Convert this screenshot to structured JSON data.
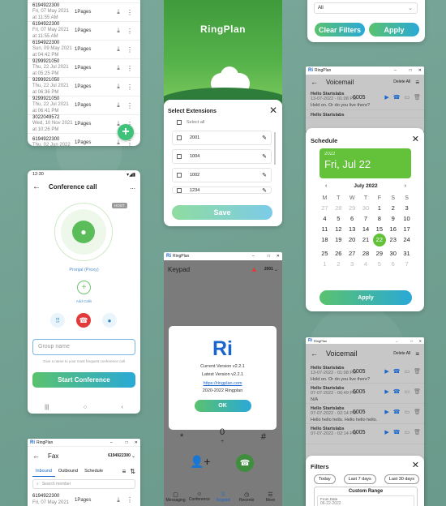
{
  "fax_list_top": {
    "rows": [
      {
        "number": "",
        "date": "at 11:55 AM",
        "pages": ""
      },
      {
        "number": "6194922300",
        "date": "Fri, 07 May 2021",
        "time": "at 11:55 AM",
        "pages": "1Pages"
      },
      {
        "number": "6194922300",
        "date": "Fri, 07 May 2021",
        "time": "at 11:55 AM",
        "pages": "1Pages"
      },
      {
        "number": "6194922300",
        "date": "Sun, 09 May 2021",
        "time": "at 04:42 PM",
        "pages": "1Pages"
      },
      {
        "number": "9299921050",
        "date": "Thu, 22 Jul 2021",
        "time": "at 05:25 PM",
        "pages": "1Pages"
      },
      {
        "number": "9299921050",
        "date": "Thu, 22 Jul 2021",
        "time": "at 06:36 PM",
        "pages": "1Pages"
      },
      {
        "number": "9299921050",
        "date": "Thu, 22 Jul 2021",
        "time": "at 06:41 PM",
        "pages": "1Pages"
      },
      {
        "number": "3022049572",
        "date": "Wed, 10 Nov 2021",
        "time": "at 10:26 PM",
        "pages": "1Pages"
      },
      {
        "number": "6194922300",
        "date": "Thu, 02 Jun 2022",
        "time": "",
        "pages": "1Pages"
      }
    ],
    "fab": "+"
  },
  "splash": {
    "brand": "RingPlan"
  },
  "filters_top": {
    "select_value": "All",
    "clear_label": "Clear Filters",
    "apply_label": "Apply"
  },
  "select_extensions": {
    "title": "Select Extensions",
    "select_all": "Select all",
    "extensions": [
      "2001",
      "1004",
      "1002",
      "1234"
    ],
    "save_label": "Save"
  },
  "conference": {
    "status_time": "12:30",
    "title": "Conference call",
    "more": "...",
    "host_badge": "HOST",
    "host_name": "Pronjal (Proxy)",
    "add_calls": "Add Calls",
    "group_placeholder": "Group name",
    "hint": "Give a name to your most frequent conference call",
    "start_label": "Start Conference"
  },
  "voicemail_top": {
    "window_title": "RingPlan",
    "title": "Voicemail",
    "delete_all": "Delete All",
    "rows": [
      {
        "title": "Hello Startslabs",
        "date": "13-07-2022 - 01:08 PM",
        "ext": "6005",
        "message": "Hold on. Or do you live there?"
      },
      {
        "title": "Hello Startslabs",
        "date": "",
        "ext": "",
        "message": ""
      }
    ]
  },
  "schedule": {
    "title": "Schedule",
    "year": "2022",
    "date_label": "Fri, Jul 22",
    "month_label": "July 2022",
    "weekdays": [
      "M",
      "T",
      "W",
      "T",
      "F",
      "S",
      "S"
    ],
    "weeks": [
      [
        "27",
        "28",
        "29",
        "30",
        "1",
        "2",
        "3"
      ],
      [
        "4",
        "5",
        "6",
        "7",
        "8",
        "9",
        "10"
      ],
      [
        "11",
        "12",
        "13",
        "14",
        "15",
        "16",
        "17"
      ],
      [
        "18",
        "19",
        "20",
        "21",
        "22",
        "23",
        "24"
      ],
      [
        "25",
        "26",
        "27",
        "28",
        "29",
        "30",
        "31"
      ],
      [
        "1",
        "2",
        "3",
        "4",
        "5",
        "6",
        "7"
      ]
    ],
    "apply_label": "Apply"
  },
  "keypad": {
    "window_title": "RingPlan",
    "title": "Keypad",
    "ext": "2001",
    "about": {
      "logo": "Ri",
      "current_version": "Current Version v2.2.1",
      "latest_version": "Latest Version v2.2.1",
      "link": "https://ringplan.com",
      "copyright": "2020-2022 Ringplan",
      "ok_label": "OK"
    },
    "keys": [
      "*",
      "0",
      "#"
    ],
    "zero_sub": "+",
    "tabs": [
      "Messaging",
      "Conference",
      "Keypad",
      "Recents",
      "More"
    ]
  },
  "voicemail_bottom": {
    "window_title": "RingPlan",
    "title": "Voicemail",
    "delete_all": "Delete All",
    "rows": [
      {
        "title": "Hello Startslabs",
        "date": "13-07-2022 - 01:08 PM",
        "ext": "6005",
        "message": "Hold on. Or do you live there?"
      },
      {
        "title": "Hello Startslabs",
        "date": "07-07-2022 - 06:49 PM",
        "ext": "6005",
        "message": "N/A"
      },
      {
        "title": "Hello Startslabs",
        "date": "07-07-2022 - 02:14 PM",
        "ext": "6005",
        "message": "Hello hello hello. Hello hello hello."
      },
      {
        "title": "Hello Startslabs",
        "date": "07-07-2022 - 02:14 PM",
        "ext": "6005",
        "message": ""
      }
    ]
  },
  "filters_bottom": {
    "title": "Filters",
    "quick": [
      "Today",
      "Last 7 days",
      "Last 30 days"
    ],
    "custom_range": "Custom Range",
    "from_label": "From Date",
    "from_value": "06-22-2022"
  },
  "fax_bottom": {
    "window_title": "RingPlan",
    "title": "Fax",
    "number": "6194922300",
    "tabs": [
      "Inbound",
      "Outbound",
      "Schedule"
    ],
    "search_placeholder": "Search member",
    "row": {
      "number": "6194922300",
      "date": "Fri, 07 May 2021",
      "pages": "1Pages"
    }
  },
  "colors": {
    "accent_green": "#5ac26e",
    "accent_blue": "#2aa9d6",
    "calendar_green": "#63c23a",
    "link_blue": "#1a66cc"
  }
}
